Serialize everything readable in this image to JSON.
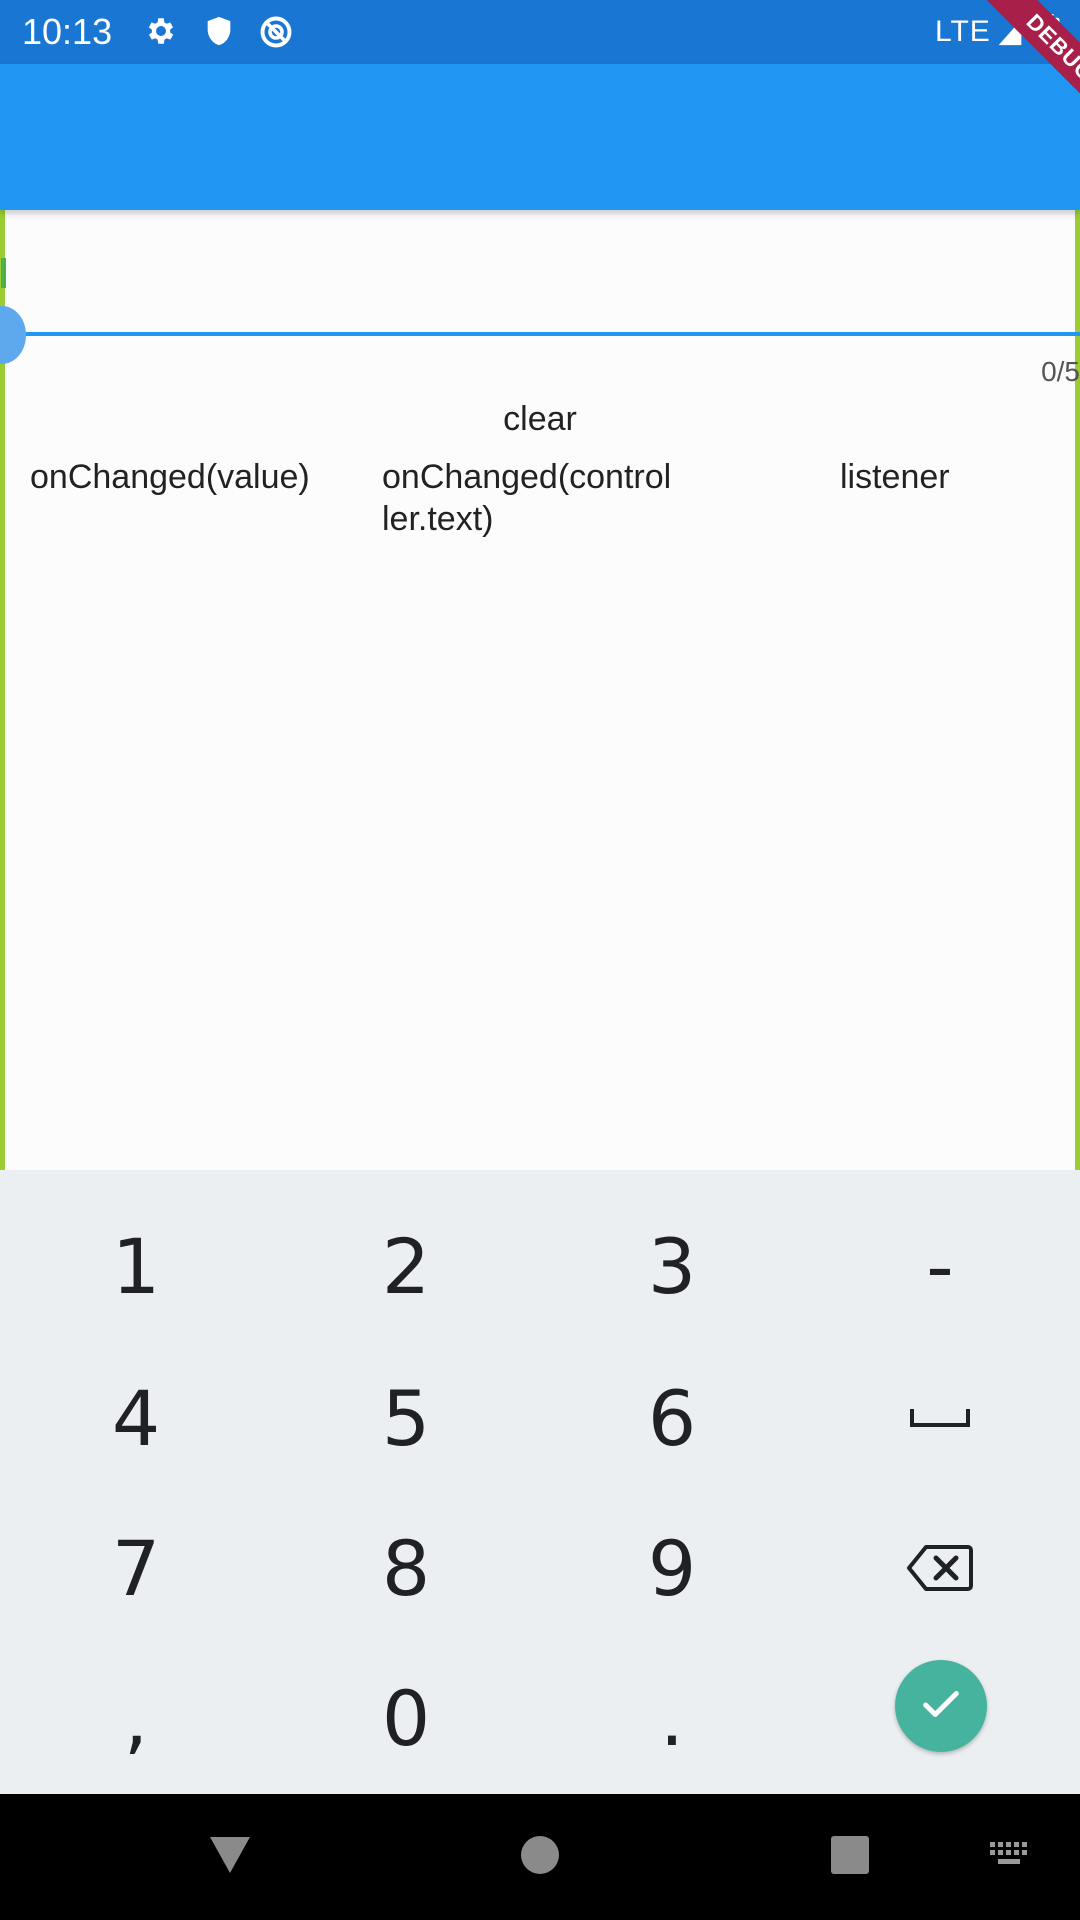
{
  "status_bar": {
    "time": "10:13",
    "network": "LTE",
    "icons": [
      "settings-icon",
      "shield-icon",
      "data-saver-icon",
      "signal-icon",
      "battery-icon"
    ]
  },
  "debug_banner": {
    "label": "DEBUG"
  },
  "text_field": {
    "value": "",
    "counter": "0/5"
  },
  "clear_button": {
    "label": "clear"
  },
  "results": {
    "on_changed_value": "onChanged(value)",
    "on_changed_controller_line1": "onChanged(control",
    "on_changed_controller_line2": "ler.text)",
    "listener": "listener"
  },
  "keyboard": {
    "rows": [
      [
        "1",
        "2",
        "3",
        "-"
      ],
      [
        "4",
        "5",
        "6",
        "space-key-icon"
      ],
      [
        "7",
        "8",
        "9",
        "backspace-icon"
      ],
      [
        ",",
        "0",
        ".",
        "done-check-icon"
      ]
    ]
  },
  "nav_bar": {
    "icons": [
      "back-icon",
      "home-icon",
      "recents-icon",
      "keyboard-switch-icon"
    ]
  },
  "colors": {
    "status_bar": "#1976d2",
    "app_bar": "#2196f3",
    "accent": "#2196f3",
    "done_key": "#45b39d",
    "keyboard_bg": "#eceff1",
    "debug_banner": "#a8204a"
  }
}
